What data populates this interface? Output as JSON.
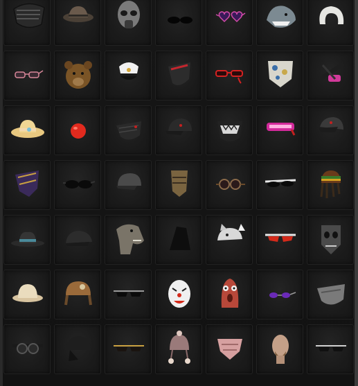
{
  "scroll_indicator": "^",
  "items": [
    {
      "name": "tactical-mask-icon"
    },
    {
      "name": "bucket-hat-icon"
    },
    {
      "name": "gas-mask-icon"
    },
    {
      "name": "dark-sunglasses-icon"
    },
    {
      "name": "heart-glasses-icon"
    },
    {
      "name": "shark-head-icon"
    },
    {
      "name": "travel-pillow-icon"
    },
    {
      "name": "pink-glasses-icon"
    },
    {
      "name": "bear-head-icon"
    },
    {
      "name": "captain-hat-icon"
    },
    {
      "name": "red-face-mask-icon"
    },
    {
      "name": "red-glasses-icon"
    },
    {
      "name": "bandana-icon"
    },
    {
      "name": "pink-goggles-icon"
    },
    {
      "name": "straw-sunhat-icon"
    },
    {
      "name": "clown-nose-icon"
    },
    {
      "name": "face-mask-icon"
    },
    {
      "name": "black-cap-icon"
    },
    {
      "name": "teeth-mask-icon"
    },
    {
      "name": "pink-visor-icon"
    },
    {
      "name": "black-cap-red-icon"
    },
    {
      "name": "gold-mask-icon"
    },
    {
      "name": "black-shades-icon"
    },
    {
      "name": "gray-cap-icon"
    },
    {
      "name": "scarf-mask-icon"
    },
    {
      "name": "steampunk-goggles-icon"
    },
    {
      "name": "white-shades-icon"
    },
    {
      "name": "dreadlock-beanie-icon"
    },
    {
      "name": "fedora-icon"
    },
    {
      "name": "flat-cap-icon"
    },
    {
      "name": "dinosaur-head-icon"
    },
    {
      "name": "hood-icon"
    },
    {
      "name": "cat-ear-hat-icon"
    },
    {
      "name": "red-sport-shades-icon"
    },
    {
      "name": "skull-mask-icon"
    },
    {
      "name": "pith-helmet-icon"
    },
    {
      "name": "aviator-hat-icon"
    },
    {
      "name": "wrap-shades-icon"
    },
    {
      "name": "clown-mask-icon"
    },
    {
      "name": "worm-mask-icon"
    },
    {
      "name": "purple-glasses-icon"
    },
    {
      "name": "gray-face-mask-icon"
    },
    {
      "name": "goggles-icon"
    },
    {
      "name": "leather-cap-icon"
    },
    {
      "name": "gold-shades-icon"
    },
    {
      "name": "pom-beanie-icon"
    },
    {
      "name": "pink-scarf-icon"
    },
    {
      "name": "bald-head-icon"
    },
    {
      "name": "silver-shades-icon"
    }
  ]
}
